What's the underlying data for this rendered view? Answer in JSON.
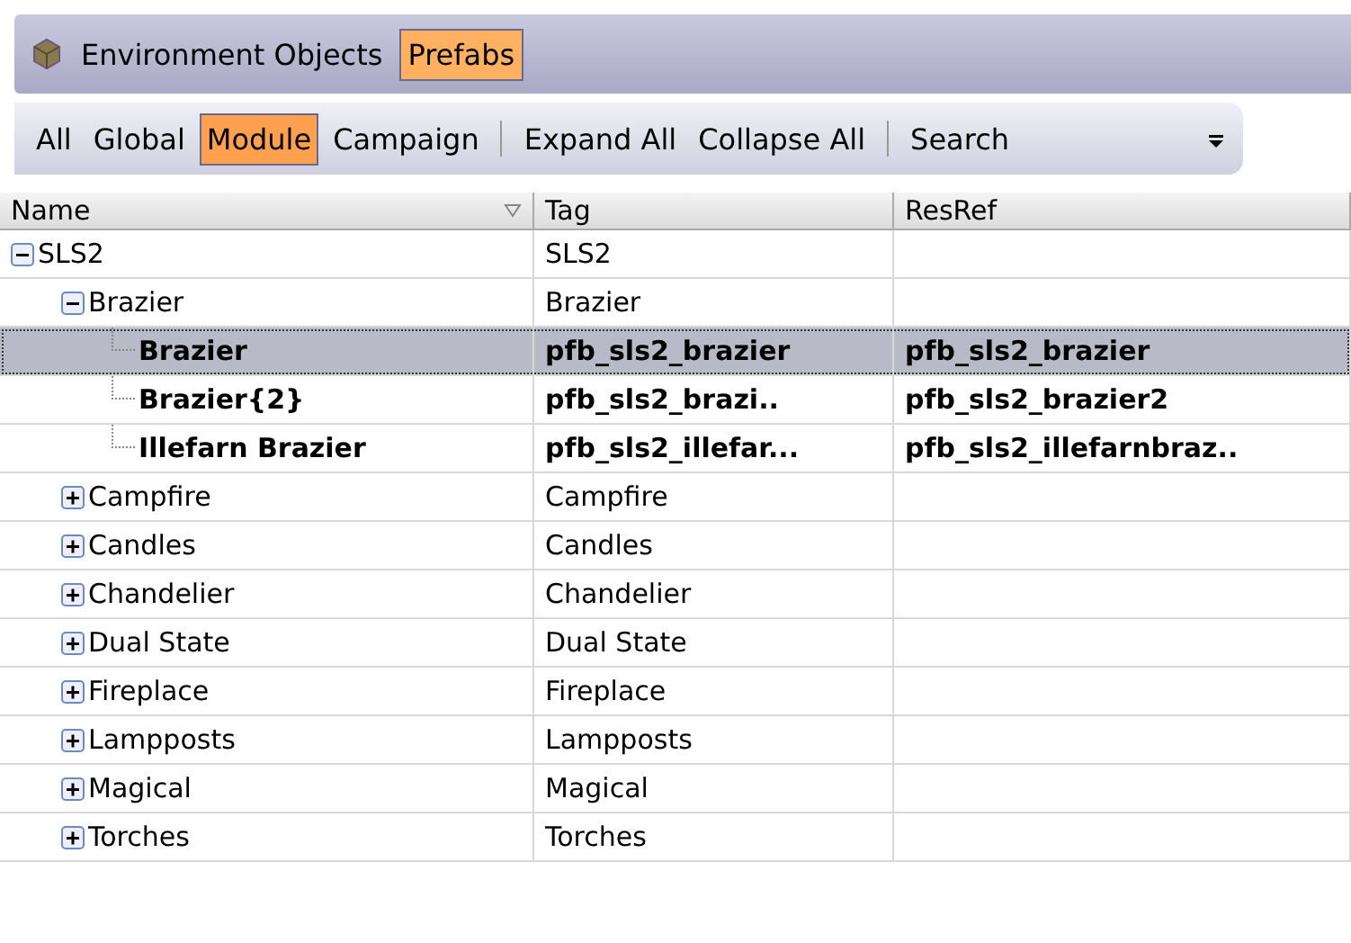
{
  "tabs": [
    {
      "label": "Environment Objects",
      "selected": false
    },
    {
      "label": "Prefabs",
      "selected": true
    }
  ],
  "toolbar": [
    {
      "kind": "button",
      "label": "All",
      "selected": false
    },
    {
      "kind": "button",
      "label": "Global",
      "selected": false
    },
    {
      "kind": "button",
      "label": "Module",
      "selected": true
    },
    {
      "kind": "button",
      "label": "Campaign",
      "selected": false
    },
    {
      "kind": "separator"
    },
    {
      "kind": "button",
      "label": "Expand All",
      "selected": false
    },
    {
      "kind": "button",
      "label": "Collapse All",
      "selected": false
    },
    {
      "kind": "separator"
    },
    {
      "kind": "button",
      "label": "Search",
      "selected": false
    }
  ],
  "table": {
    "columns": [
      "Name",
      "Tag",
      "ResRef"
    ],
    "rows": [
      {
        "kind": "folder",
        "name": "SLS2",
        "tag": "SLS2",
        "expanded": true,
        "selected": false,
        "children": [
          {
            "kind": "folder",
            "name": "Brazier",
            "tag": "Brazier",
            "expanded": true,
            "selected": false,
            "children": [
              {
                "kind": "prefab",
                "name": "Brazier",
                "tag": "pfb_sls2_brazier",
                "resref": "pfb_sls2_brazier",
                "selected": true
              },
              {
                "kind": "prefab",
                "name": "Brazier{2}",
                "tag": "pfb_sls2_brazi..",
                "resref": "pfb_sls2_brazier2",
                "selected": false
              },
              {
                "kind": "prefab",
                "name": "Illefarn Brazier",
                "tag": "pfb_sls2_illefar...",
                "resref": "pfb_sls2_illefarnbraz..",
                "selected": false
              }
            ]
          },
          {
            "kind": "folder",
            "name": "Campfire",
            "tag": "Campfire",
            "expanded": false,
            "selected": false
          },
          {
            "kind": "folder",
            "name": "Candles",
            "tag": "Candles",
            "expanded": false,
            "selected": false
          },
          {
            "kind": "folder",
            "name": "Chandelier",
            "tag": "Chandelier",
            "expanded": false,
            "selected": false
          },
          {
            "kind": "folder",
            "name": "Dual State",
            "tag": "Dual State",
            "expanded": false,
            "selected": false
          },
          {
            "kind": "folder",
            "name": "Fireplace",
            "tag": "Fireplace",
            "expanded": false,
            "selected": false
          },
          {
            "kind": "folder",
            "name": "Lampposts",
            "tag": "Lampposts",
            "expanded": false,
            "selected": false
          },
          {
            "kind": "folder",
            "name": "Magical",
            "tag": "Magical",
            "expanded": false,
            "selected": false
          },
          {
            "kind": "folder",
            "name": "Torches",
            "tag": "Torches",
            "expanded": false,
            "selected": false
          }
        ]
      }
    ]
  }
}
